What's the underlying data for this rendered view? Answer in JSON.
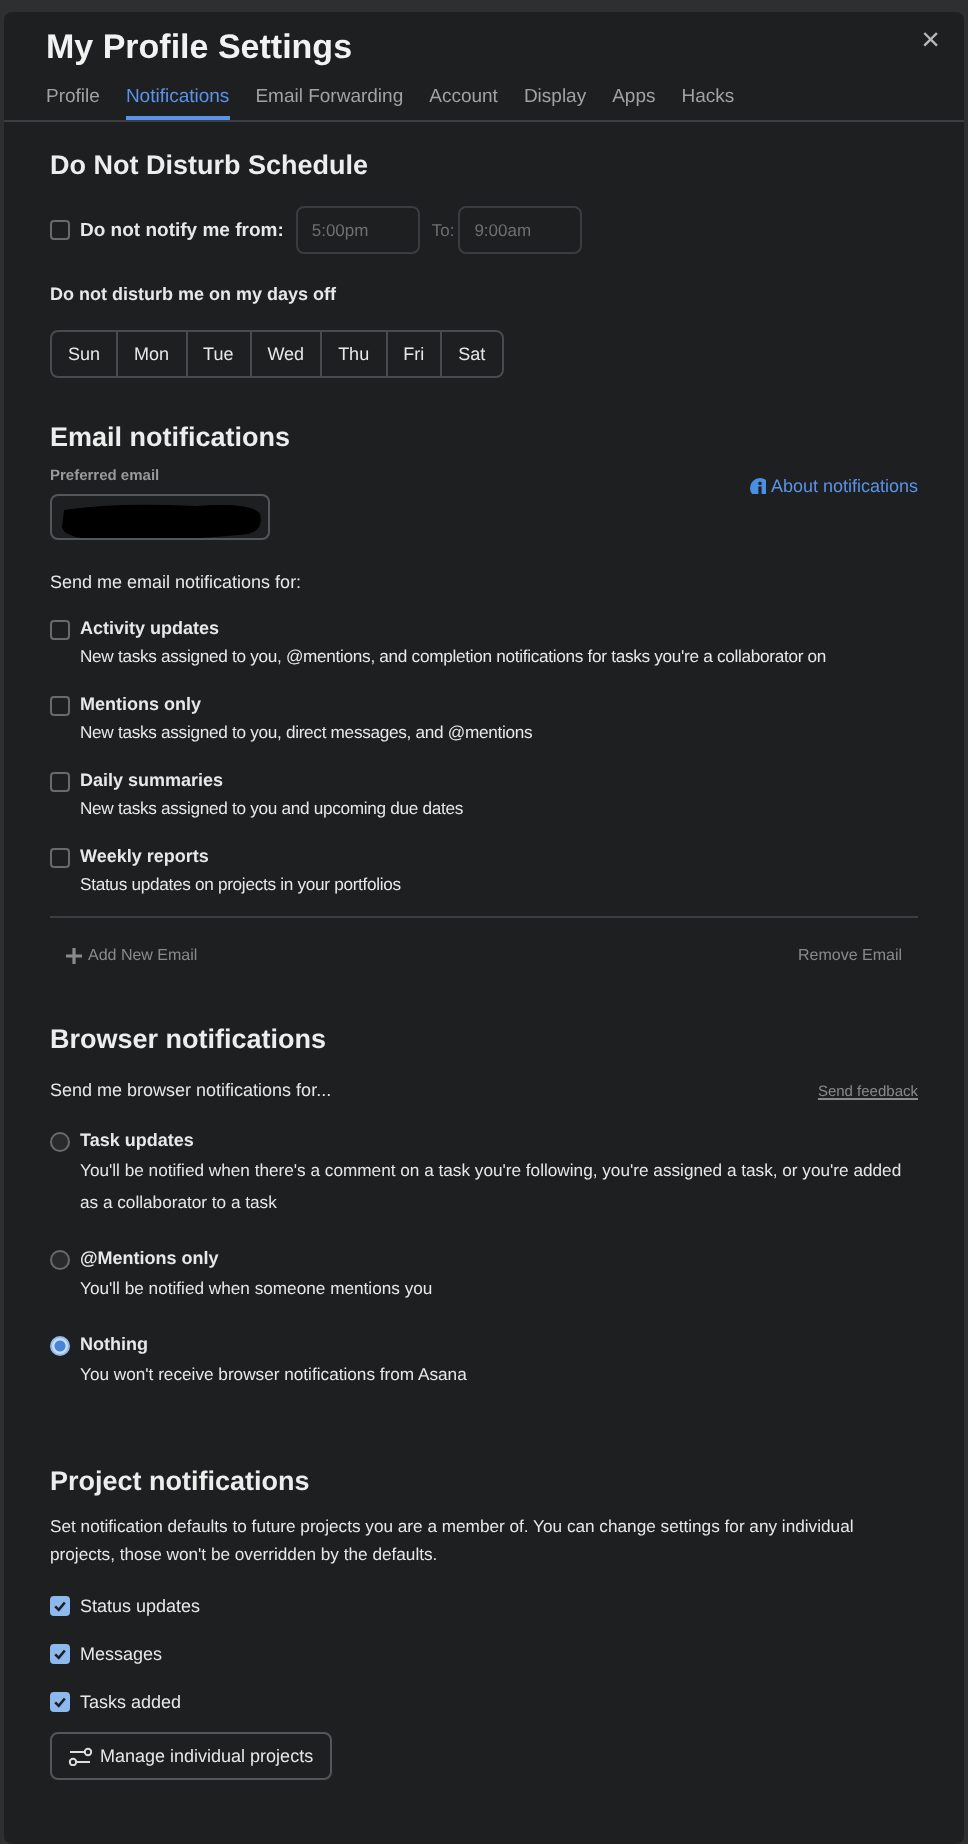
{
  "window": {
    "title": "My Profile Settings",
    "close": "×"
  },
  "tabs": [
    {
      "label": "Profile",
      "selected": false
    },
    {
      "label": "Notifications",
      "selected": true
    },
    {
      "label": "Email Forwarding",
      "selected": false
    },
    {
      "label": "Account",
      "selected": false
    },
    {
      "label": "Display",
      "selected": false
    },
    {
      "label": "Apps",
      "selected": false
    },
    {
      "label": "Hacks",
      "selected": false
    }
  ],
  "dnd": {
    "title": "Do Not Disturb Schedule",
    "checked": false,
    "label": "Do not notify me from:",
    "from": {
      "placeholder": "5:00pm"
    },
    "to_label": "To:",
    "to": {
      "placeholder": "9:00am"
    },
    "days_label": "Do not disturb me on my days off",
    "days": [
      {
        "label": "Sun",
        "selected": false
      },
      {
        "label": "Mon",
        "selected": false
      },
      {
        "label": "Tue",
        "selected": false
      },
      {
        "label": "Wed",
        "selected": false
      },
      {
        "label": "Thu",
        "selected": false
      },
      {
        "label": "Fri",
        "selected": false
      },
      {
        "label": "Sat",
        "selected": false
      }
    ]
  },
  "email": {
    "title": "Email notifications",
    "field_label": "Preferred email",
    "about_link": "About notifications",
    "redacted": true,
    "intro": "Send me email notifications for:",
    "options": [
      {
        "label": "Activity updates",
        "description": "New tasks assigned to you, @mentions, and completion notifications for tasks you're a collaborator on",
        "checked": false
      },
      {
        "label": "Mentions only",
        "description": "New tasks assigned to you, direct messages, and @mentions",
        "checked": false
      },
      {
        "label": "Daily summaries",
        "description": "New tasks assigned to you and upcoming due dates",
        "checked": false
      },
      {
        "label": "Weekly reports",
        "description": "Status updates on projects in your portfolios",
        "checked": false
      }
    ],
    "add": "Add New Email",
    "remove": "Remove Email"
  },
  "browser": {
    "title": "Browser notifications",
    "intro": "Send me browser notifications for...",
    "feedback": "Send feedback",
    "options": [
      {
        "label": "Task updates",
        "description": "You'll be notified when there's a comment on a task you're following, you're assigned a task, or you're added as a collaborator to a task",
        "selected": false
      },
      {
        "label": "@Mentions only",
        "description": "You'll be notified when someone mentions you",
        "selected": false
      },
      {
        "label": "Nothing",
        "description": "You won't receive browser notifications from Asana",
        "selected": true
      }
    ]
  },
  "project": {
    "title": "Project notifications",
    "description": "Set notification defaults to future projects you are a member of. You can change settings for any individual projects, those won't be overridden by the defaults.",
    "options": [
      {
        "label": "Status updates",
        "checked": true
      },
      {
        "label": "Messages",
        "checked": true
      },
      {
        "label": "Tasks added",
        "checked": true
      }
    ],
    "button": "Manage individual projects"
  }
}
